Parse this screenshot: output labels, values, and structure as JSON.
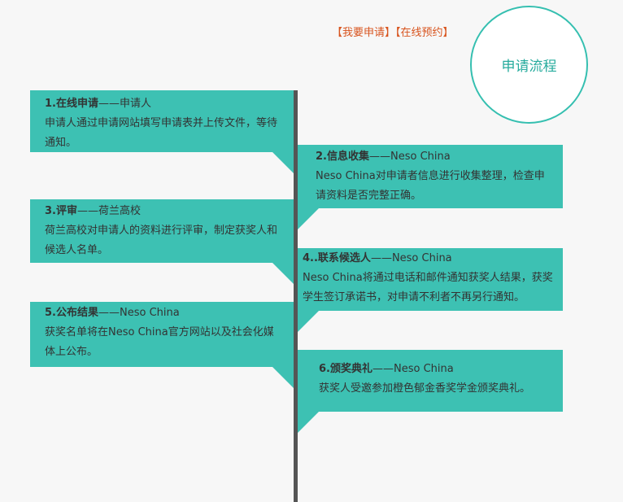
{
  "top_links": {
    "apply": "【我要申请】",
    "booking": "【在线预约】"
  },
  "circle_title": "申请流程",
  "steps": [
    {
      "title": "1.在线申请",
      "role": "——申请人",
      "desc": "申请人通过申请网站填写申请表并上传文件，等待通知。"
    },
    {
      "title": "2.信息收集",
      "role": "——Neso  China",
      "desc": "Neso  China对申请者信息进行收集整理，检查申请资料是否完整正确。"
    },
    {
      "title": "3.评审",
      "role": "——荷兰高校",
      "desc": "荷兰高校对申请人的资料进行评审，制定获奖人和候选人名单。"
    },
    {
      "title": "4..联系候选人",
      "role": "——Neso  China",
      "desc": "Neso  China将通过电话和邮件通知获奖人结果，获奖学生签订承诺书，对申请不利者不再另行通知。"
    },
    {
      "title": "5.公布结果",
      "role": "——Neso  China",
      "desc": "获奖名单将在Neso  China官方网站以及社会化媒体上公布。"
    },
    {
      "title": "6.颁奖典礼",
      "role": "——Neso  China",
      "desc": "获奖人受邀参加橙色郁金香奖学金颁奖典礼。"
    }
  ],
  "colors": {
    "box": "#3dc1b3",
    "circle_border": "#35bfb0",
    "link": "#d8541e",
    "line": "#555555"
  }
}
